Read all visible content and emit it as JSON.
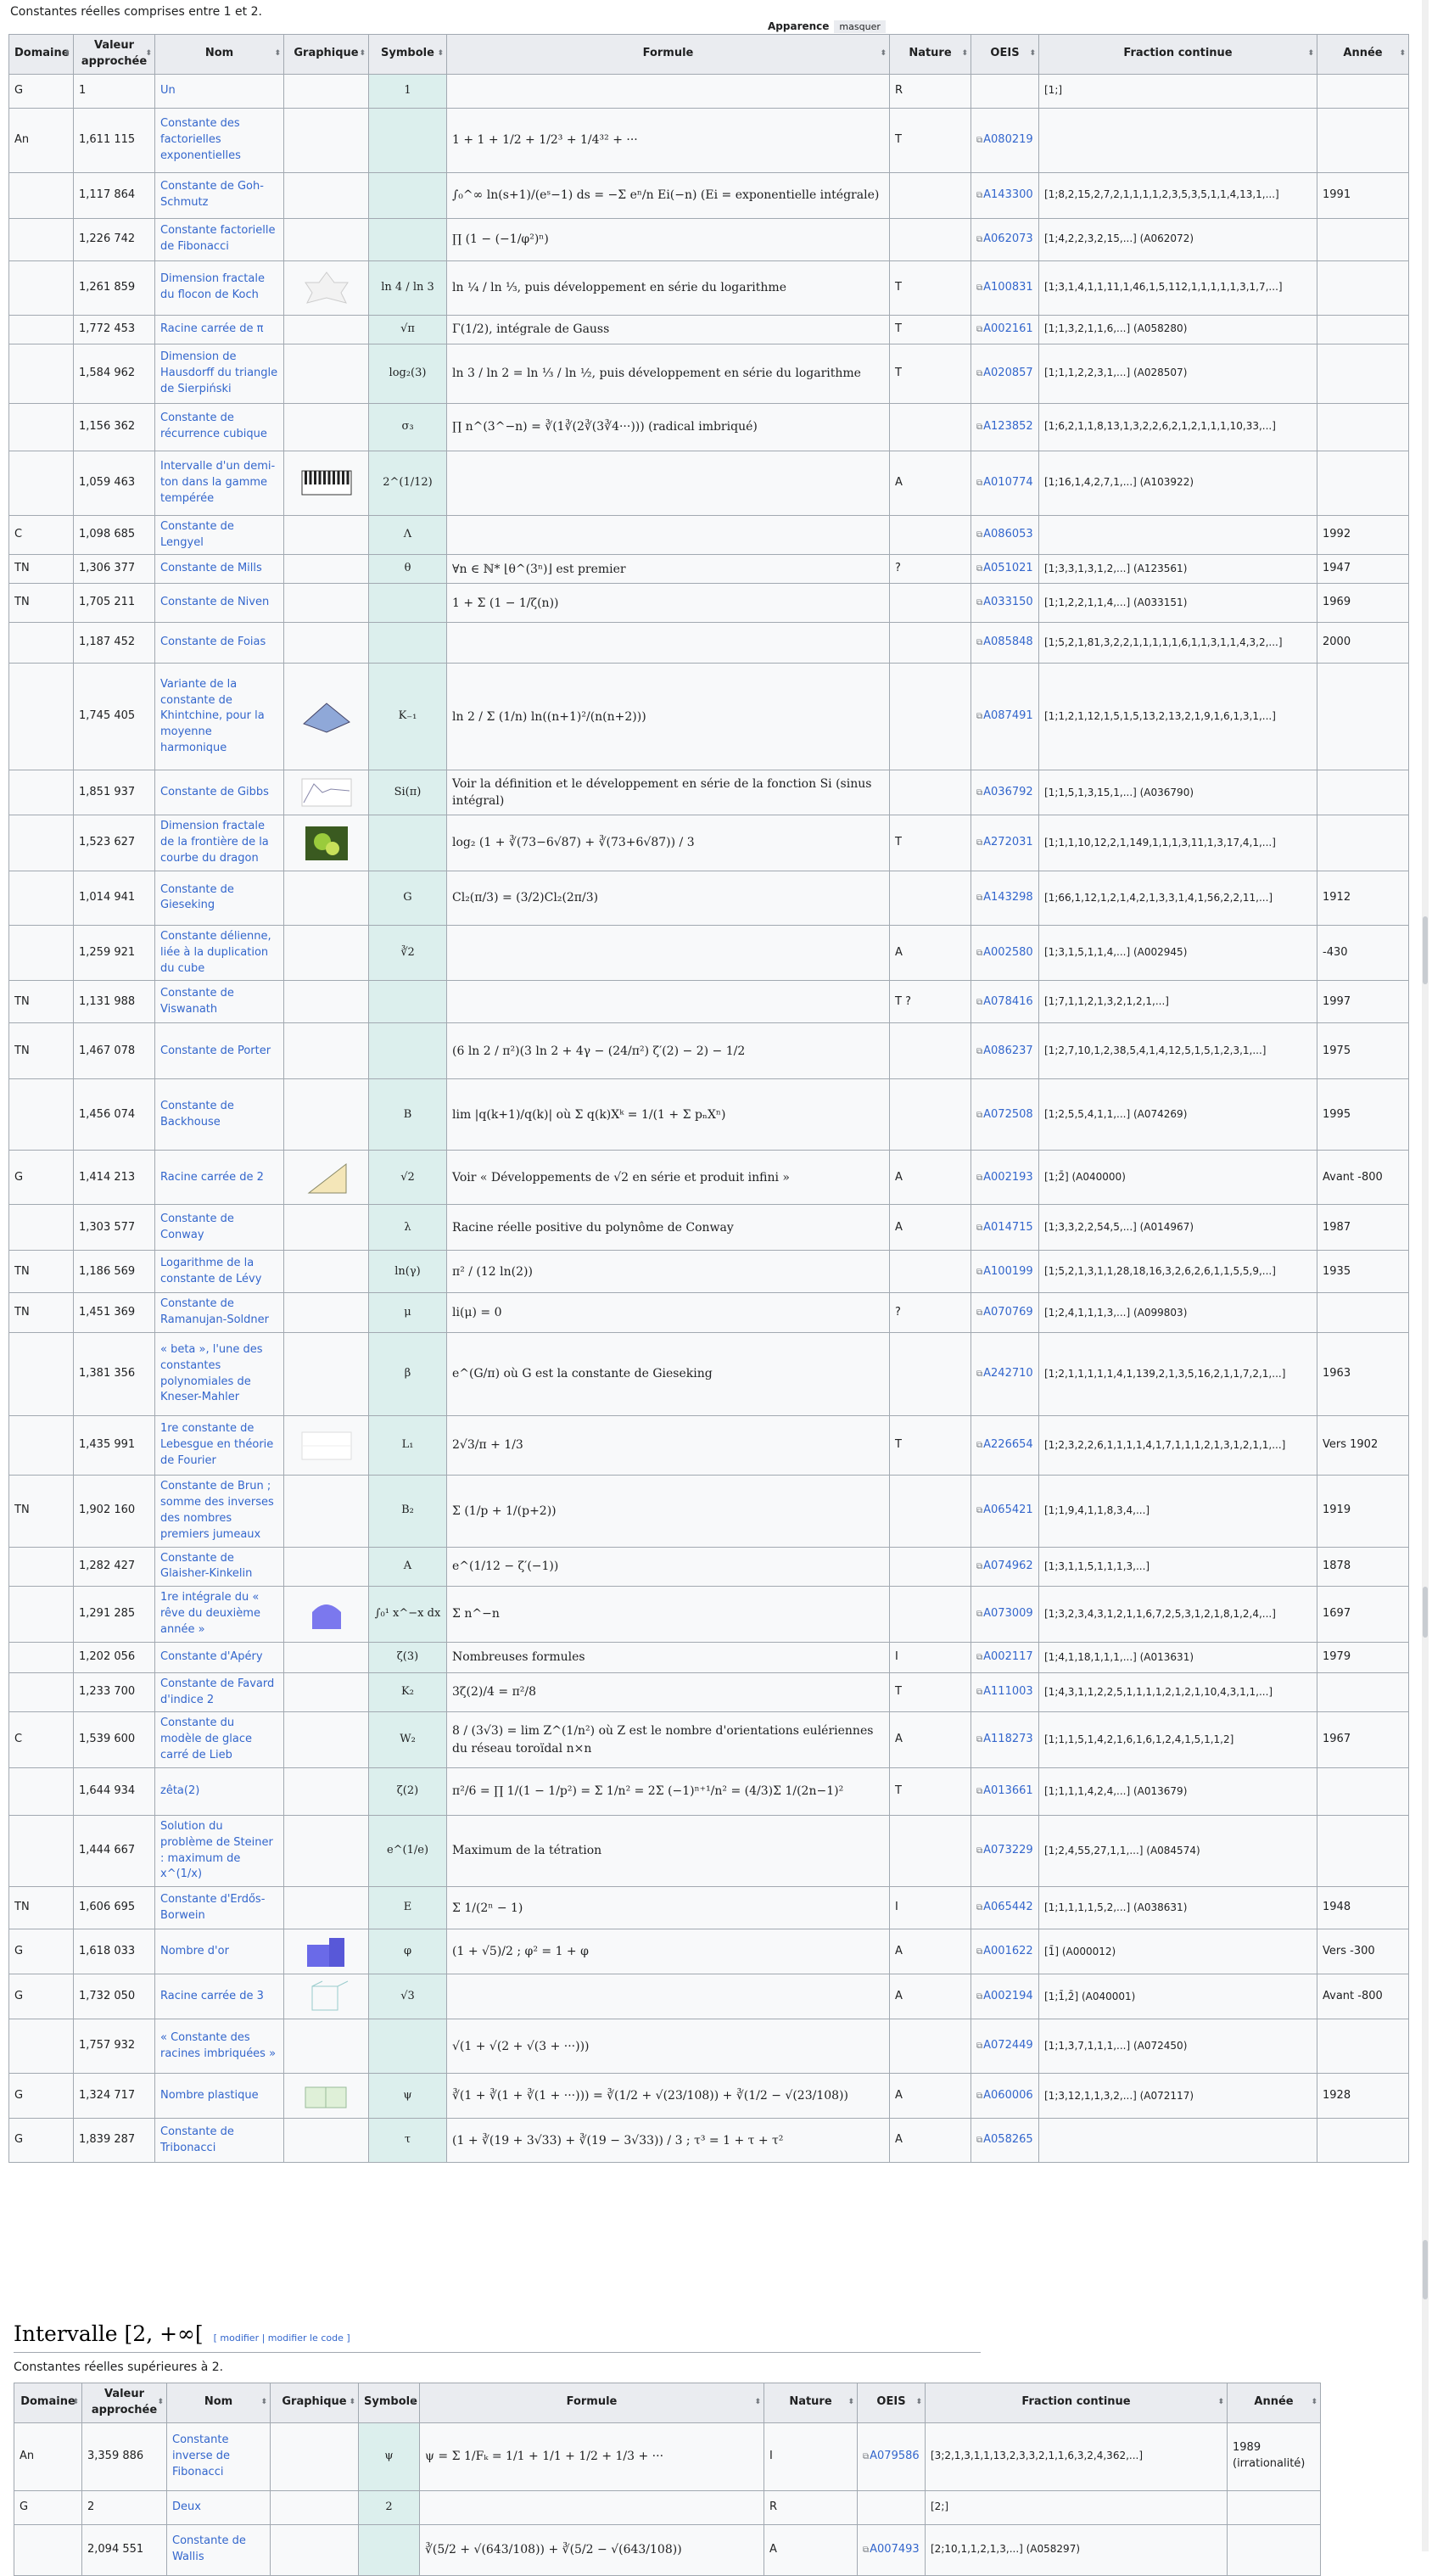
{
  "caption_top": "Constantes réelles comprises entre 1 et 2.",
  "appearance": {
    "label": "Apparence",
    "toggle": "masquer"
  },
  "headers": [
    "Domaine",
    "Valeur approchée",
    "Nom",
    "Graphique",
    "Symbole",
    "Formule",
    "Nature",
    "OEIS",
    "Fraction continue",
    "Année"
  ],
  "rows": [
    {
      "dom": "G",
      "val": "1",
      "nom": "Un",
      "sym": "1",
      "form": "",
      "nat": "R",
      "oeis": "",
      "cf": "[1;]",
      "an": ""
    },
    {
      "dom": "An",
      "val": "1,611 115",
      "nom": "Constante des factorielles exponentielles",
      "sym": "",
      "form": "1 + 1 + 1/2 + 1/2³ + 1/4³² + ···",
      "nat": "T",
      "oeis": "A080219",
      "cf": "",
      "an": ""
    },
    {
      "dom": "",
      "val": "1,117 864",
      "nom": "Constante de Goh-Schmutz",
      "sym": "",
      "form": "∫₀^∞ ln(s+1)/(eˢ−1) ds = −Σ eⁿ/n Ei(−n) (Ei = exponentielle intégrale)",
      "nat": "",
      "oeis": "A143300",
      "cf": "[1;8,2,15,2,7,2,1,1,1,1,2,3,5,3,5,1,1,4,13,1,...]",
      "an": "1991"
    },
    {
      "dom": "",
      "val": "1,226 742",
      "nom": "Constante factorielle de Fibonacci",
      "sym": "",
      "form": "∏ (1 − (−1/φ²)ⁿ)",
      "nat": "",
      "oeis": "A062073",
      "cf": "[1;4,2,2,3,2,15,...] (A062072)",
      "an": ""
    },
    {
      "dom": "",
      "val": "1,261 859",
      "nom": "Dimension fractale du flocon de Koch",
      "sym": "ln 4 / ln 3",
      "form": "ln ¼ / ln ⅓, puis développement en série du logarithme",
      "nat": "T",
      "oeis": "A100831",
      "cf": "[1;3,1,4,1,1,11,1,46,1,5,112,1,1,1,1,1,3,1,7,...]",
      "an": ""
    },
    {
      "dom": "",
      "val": "1,772 453",
      "nom": "Racine carrée de π",
      "sym": "√π",
      "form": "Γ(1/2), intégrale de Gauss",
      "nat": "T",
      "oeis": "A002161",
      "cf": "[1;1,3,2,1,1,6,...] (A058280)",
      "an": ""
    },
    {
      "dom": "",
      "val": "1,584 962",
      "nom": "Dimension de Hausdorff du triangle de Sierpiński",
      "sym": "log₂(3)",
      "form": "ln 3 / ln 2 = ln ⅓ / ln ½, puis développement en série du logarithme",
      "nat": "T",
      "oeis": "A020857",
      "cf": "[1;1,1,2,2,3,1,...] (A028507)",
      "an": ""
    },
    {
      "dom": "",
      "val": "1,156 362",
      "nom": "Constante de récurrence cubique",
      "sym": "σ₃",
      "form": "∏ n^(3^−n) = ∛(1∛(2∛(3∛4···))) (radical imbriqué)",
      "nat": "",
      "oeis": "A123852",
      "cf": "[1;6,2,1,1,8,13,1,3,2,2,6,2,1,2,1,1,1,10,33,...]",
      "an": ""
    },
    {
      "dom": "",
      "val": "1,059 463",
      "nom": "Intervalle d'un demi-ton dans la gamme tempérée",
      "sym": "2^(1/12)",
      "form": "",
      "nat": "A",
      "oeis": "A010774",
      "cf": "[1;16,1,4,2,7,1,...] (A103922)",
      "an": ""
    },
    {
      "dom": "C",
      "val": "1,098 685",
      "nom": "Constante de Lengyel",
      "sym": "Λ",
      "form": "",
      "nat": "",
      "oeis": "A086053",
      "cf": "",
      "an": "1992"
    },
    {
      "dom": "TN",
      "val": "1,306 377",
      "nom": "Constante de Mills",
      "sym": "θ",
      "form": "∀n ∈ ℕ*  ⌊θ^(3ⁿ)⌋ est premier",
      "nat": "?",
      "oeis": "A051021",
      "cf": "[1;3,3,1,3,1,2,...] (A123561)",
      "an": "1947"
    },
    {
      "dom": "TN",
      "val": "1,705 211",
      "nom": "Constante de Niven",
      "sym": "",
      "form": "1 + Σ (1 − 1/ζ(n))",
      "nat": "",
      "oeis": "A033150",
      "cf": "[1;1,2,2,1,1,4,...] (A033151)",
      "an": "1969"
    },
    {
      "dom": "",
      "val": "1,187 452",
      "nom": "Constante de Foias",
      "sym": "",
      "form": "",
      "nat": "",
      "oeis": "A085848",
      "cf": "[1;5,2,1,81,3,2,2,1,1,1,1,1,6,1,1,3,1,1,4,3,2,...]",
      "an": "2000"
    },
    {
      "dom": "",
      "val": "1,745 405",
      "nom": "Variante de la constante de Khintchine, pour la moyenne harmonique",
      "sym": "K₋₁",
      "form": "ln 2 / Σ (1/n) ln((n+1)²/(n(n+2)))",
      "nat": "",
      "oeis": "A087491",
      "cf": "[1;1,2,1,12,1,5,1,5,13,2,13,2,1,9,1,6,1,3,1,...]",
      "an": ""
    },
    {
      "dom": "",
      "val": "1,851 937",
      "nom": "Constante de Gibbs",
      "sym": "Si(π)",
      "form": "Voir la définition et le développement en série de la fonction Si (sinus intégral)",
      "nat": "",
      "oeis": "A036792",
      "cf": "[1;1,5,1,3,15,1,...] (A036790)",
      "an": ""
    },
    {
      "dom": "",
      "val": "1,523 627",
      "nom": "Dimension fractale de la frontière de la courbe du dragon",
      "sym": "",
      "form": "log₂ (1 + ∛(73−6√87) + ∛(73+6√87)) / 3",
      "nat": "T",
      "oeis": "A272031",
      "cf": "[1;1,1,10,12,2,1,149,1,1,1,3,11,1,3,17,4,1,...]",
      "an": ""
    },
    {
      "dom": "",
      "val": "1,014 941",
      "nom": "Constante de Gieseking",
      "sym": "G",
      "form": "Cl₂(π/3) = (3/2)Cl₂(2π/3)",
      "nat": "",
      "oeis": "A143298",
      "cf": "[1;66,1,12,1,2,1,4,2,1,3,3,1,4,1,56,2,2,11,...]",
      "an": "1912"
    },
    {
      "dom": "",
      "val": "1,259 921",
      "nom": "Constante délienne, liée à la duplication du cube",
      "sym": "∛2",
      "form": "",
      "nat": "A",
      "oeis": "A002580",
      "cf": "[1;3,1,5,1,1,4,...] (A002945)",
      "an": "-430"
    },
    {
      "dom": "TN",
      "val": "1,131 988",
      "nom": "Constante de Viswanath",
      "sym": "",
      "form": "",
      "nat": "T ?",
      "oeis": "A078416",
      "cf": "[1;7,1,1,2,1,3,2,1,2,1,...]",
      "an": "1997"
    },
    {
      "dom": "TN",
      "val": "1,467 078",
      "nom": "Constante de Porter",
      "sym": "",
      "form": "(6 ln 2 / π²)(3 ln 2 + 4γ − (24/π²) ζ′(2) − 2) − 1/2",
      "nat": "",
      "oeis": "A086237",
      "cf": "[1;2,7,10,1,2,38,5,4,1,4,12,5,1,5,1,2,3,1,...]",
      "an": "1975"
    },
    {
      "dom": "",
      "val": "1,456 074",
      "nom": "Constante de Backhouse",
      "sym": "B",
      "form": "lim |q(k+1)/q(k)| où Σ q(k)Xᵏ = 1/(1 + Σ pₙXⁿ)",
      "nat": "",
      "oeis": "A072508",
      "cf": "[1;2,5,5,4,1,1,...] (A074269)",
      "an": "1995"
    },
    {
      "dom": "G",
      "val": "1,414 213",
      "nom": "Racine carrée de 2",
      "sym": "√2",
      "form": "Voir « Développements de √2 en série et produit infini »",
      "nat": "A",
      "oeis": "A002193",
      "cf": "[1;2̄] (A040000)",
      "an": "Avant -800"
    },
    {
      "dom": "",
      "val": "1,303 577",
      "nom": "Constante de Conway",
      "sym": "λ",
      "form": "Racine réelle positive du polynôme de Conway",
      "nat": "A",
      "oeis": "A014715",
      "cf": "[1;3,3,2,2,54,5,...] (A014967)",
      "an": "1987"
    },
    {
      "dom": "TN",
      "val": "1,186 569",
      "nom": "Logarithme de la constante de Lévy",
      "sym": "ln(γ)",
      "form": "π² / (12 ln(2))",
      "nat": "",
      "oeis": "A100199",
      "cf": "[1;5,2,1,3,1,1,28,18,16,3,2,6,2,6,1,1,5,5,9,...]",
      "an": "1935"
    },
    {
      "dom": "TN",
      "val": "1,451 369",
      "nom": "Constante de Ramanujan-Soldner",
      "sym": "μ",
      "form": "li(μ) = 0",
      "nat": "?",
      "oeis": "A070769",
      "cf": "[1;2,4,1,1,1,3,...] (A099803)",
      "an": ""
    },
    {
      "dom": "",
      "val": "1,381 356",
      "nom": "« beta », l'une des constantes polynomiales de Kneser-Mahler",
      "sym": "β",
      "form": "e^(G/π) où G est la constante de Gieseking",
      "nat": "",
      "oeis": "A242710",
      "cf": "[1;2,1,1,1,1,1,4,1,139,2,1,3,5,16,2,1,1,7,2,1,...]",
      "an": "1963"
    },
    {
      "dom": "",
      "val": "1,435 991",
      "nom": "1re constante de Lebesgue en théorie de Fourier",
      "sym": "L₁",
      "form": "2√3/π + 1/3",
      "nat": "T",
      "oeis": "A226654",
      "cf": "[1;2,3,2,2,6,1,1,1,1,4,1,7,1,1,1,2,1,3,1,2,1,1,...]",
      "an": "Vers 1902"
    },
    {
      "dom": "TN",
      "val": "1,902 160",
      "nom": "Constante de Brun ; somme des inverses des nombres premiers jumeaux",
      "sym": "B₂",
      "form": "Σ (1/p + 1/(p+2))",
      "nat": "",
      "oeis": "A065421",
      "cf": "[1;1,9,4,1,1,8,3,4,...]",
      "an": "1919"
    },
    {
      "dom": "",
      "val": "1,282 427",
      "nom": "Constante de Glaisher-Kinkelin",
      "sym": "A",
      "form": "e^(1/12 − ζ′(−1))",
      "nat": "",
      "oeis": "A074962",
      "cf": "[1;3,1,1,5,1,1,1,3,...]",
      "an": "1878"
    },
    {
      "dom": "",
      "val": "1,291 285",
      "nom": "1re intégrale du « rêve du deuxième année »",
      "sym": "∫₀¹ x^−x dx",
      "form": "Σ n^−n",
      "nat": "",
      "oeis": "A073009",
      "cf": "[1;3,2,3,4,3,1,2,1,1,6,7,2,5,3,1,2,1,8,1,2,4,...]",
      "an": "1697"
    },
    {
      "dom": "",
      "val": "1,202 056",
      "nom": "Constante d'Apéry",
      "sym": "ζ(3)",
      "form": "Nombreuses formules",
      "nat": "I",
      "oeis": "A002117",
      "cf": "[1;4,1,18,1,1,1,...] (A013631)",
      "an": "1979"
    },
    {
      "dom": "",
      "val": "1,233 700",
      "nom": "Constante de Favard d'indice 2",
      "sym": "K₂",
      "form": "3ζ(2)/4 = π²/8",
      "nat": "T",
      "oeis": "A111003",
      "cf": "[1;4,3,1,1,2,2,5,1,1,1,1,2,1,2,1,10,4,3,1,1,...]",
      "an": ""
    },
    {
      "dom": "C",
      "val": "1,539 600",
      "nom": "Constante du modèle de glace carré de Lieb",
      "sym": "W₂",
      "form": "8 / (3√3) = lim Z^(1/n²) où Z est le nombre d'orientations eulériennes du réseau toroïdal n×n",
      "nat": "A",
      "oeis": "A118273",
      "cf": "[1;1,1,5,1,4,2,1,6,1,6,1,2,4,1,5,1,1,2]",
      "an": "1967"
    },
    {
      "dom": "",
      "val": "1,644 934",
      "nom": "zêta(2)",
      "sym": "ζ(2)",
      "form": "π²/6 = ∏ 1/(1 − 1/p²) = Σ 1/n² = 2Σ (−1)ⁿ⁺¹/n² = (4/3)Σ 1/(2n−1)²",
      "nat": "T",
      "oeis": "A013661",
      "cf": "[1;1,1,1,4,2,4,...] (A013679)",
      "an": ""
    },
    {
      "dom": "",
      "val": "1,444 667",
      "nom": "Solution du problème de Steiner : maximum de x^(1/x)",
      "sym": "e^(1/e)",
      "form": "Maximum de la tétration",
      "nat": "",
      "oeis": "A073229",
      "cf": "[1;2,4,55,27,1,1,...] (A084574)",
      "an": ""
    },
    {
      "dom": "TN",
      "val": "1,606 695",
      "nom": "Constante d'Erdős-Borwein",
      "sym": "E",
      "form": "Σ 1/(2ⁿ − 1)",
      "nat": "I",
      "oeis": "A065442",
      "cf": "[1;1,1,1,1,5,2,...] (A038631)",
      "an": "1948"
    },
    {
      "dom": "G",
      "val": "1,618 033",
      "nom": "Nombre d'or",
      "sym": "φ",
      "form": "(1 + √5)/2 ; φ² = 1 + φ",
      "nat": "A",
      "oeis": "A001622",
      "cf": "[1̄] (A000012)",
      "an": "Vers -300"
    },
    {
      "dom": "G",
      "val": "1,732 050",
      "nom": "Racine carrée de 3",
      "sym": "√3",
      "form": "",
      "nat": "A",
      "oeis": "A002194",
      "cf": "[1;1̄,2̄] (A040001)",
      "an": "Avant -800"
    },
    {
      "dom": "",
      "val": "1,757 932",
      "nom": "« Constante des racines imbriquées »",
      "sym": "",
      "form": "√(1 + √(2 + √(3 + ···)))",
      "nat": "",
      "oeis": "A072449",
      "cf": "[1;1,3,7,1,1,1,...] (A072450)",
      "an": ""
    },
    {
      "dom": "G",
      "val": "1,324 717",
      "nom": "Nombre plastique",
      "sym": "ψ",
      "form": "∛(1 + ∛(1 + ∛(1 + ···))) = ∛(1/2 + √(23/108)) + ∛(1/2 − √(23/108))",
      "nat": "A",
      "oeis": "A060006",
      "cf": "[1;3,12,1,1,3,2,...] (A072117)",
      "an": "1928"
    },
    {
      "dom": "G",
      "val": "1,839 287",
      "nom": "Constante de Tribonacci",
      "sym": "τ",
      "form": "(1 + ∛(19 + 3√33) + ∛(19 − 3√33)) / 3 ; τ³ = 1 + τ + τ²",
      "nat": "A",
      "oeis": "A058265",
      "cf": "",
      "an": ""
    }
  ],
  "section2": {
    "title": "Intervalle [2, +∞[",
    "edit": "[ modifier | modifier le code ]",
    "caption": "Constantes réelles supérieures à 2.",
    "rows": [
      {
        "dom": "An",
        "val": "3,359 886",
        "nom": "Constante inverse de Fibonacci",
        "sym": "ψ",
        "form": "ψ = Σ 1/Fₖ = 1/1 + 1/1 + 1/2 + 1/3 + ···",
        "nat": "I",
        "oeis": "A079586",
        "cf": "[3;2,1,3,1,1,13,2,3,3,2,1,1,6,3,2,4,362,...]",
        "an": "1989 (irrationalité)"
      },
      {
        "dom": "G",
        "val": "2",
        "nom": "Deux",
        "sym": "2",
        "form": "",
        "nat": "R",
        "oeis": "",
        "cf": "[2;]",
        "an": ""
      },
      {
        "dom": "",
        "val": "2,094 551",
        "nom": "Constante de Wallis",
        "sym": "",
        "form": "∛(5/2 + √(643/108)) + ∛(5/2 − √(643/108))",
        "nat": "A",
        "oeis": "A007493",
        "cf": "[2;10,1,1,2,1,3,...] (A058297)",
        "an": ""
      }
    ]
  }
}
